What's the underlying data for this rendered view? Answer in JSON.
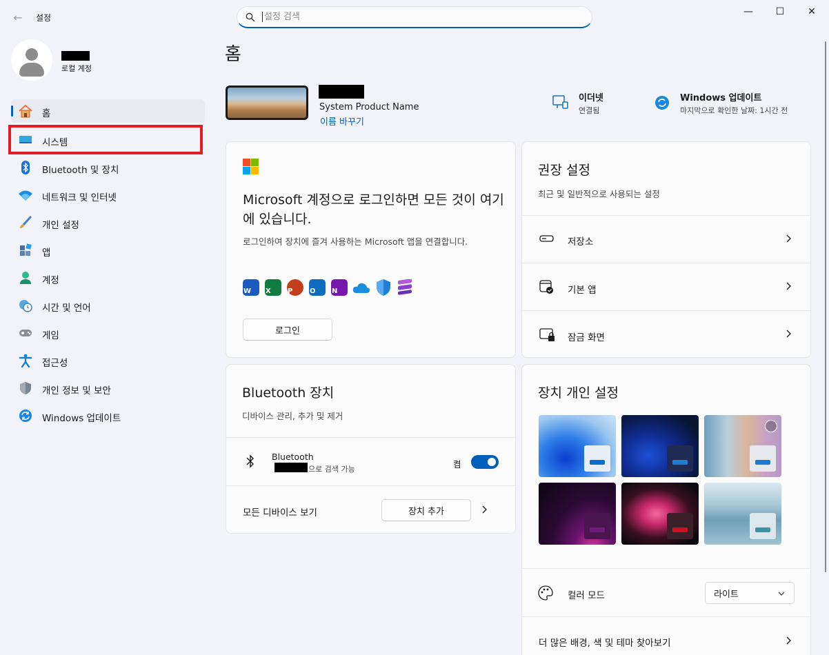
{
  "window": {
    "title": "설정",
    "back_glyph": "←",
    "minimize_glyph": "—",
    "maximize_glyph": "☐",
    "close_glyph": "✕"
  },
  "search": {
    "placeholder": "설정 검색"
  },
  "user": {
    "account_type": "로컬 계정"
  },
  "sidebar": {
    "items": [
      {
        "label": "홈",
        "icon": "home-icon"
      },
      {
        "label": "시스템",
        "icon": "monitor-icon"
      },
      {
        "label": "Bluetooth 및 장치",
        "icon": "bluetooth-icon"
      },
      {
        "label": "네트워크 및 인터넷",
        "icon": "wifi-icon"
      },
      {
        "label": "개인 설정",
        "icon": "paintbrush-icon"
      },
      {
        "label": "앱",
        "icon": "apps-icon"
      },
      {
        "label": "계정",
        "icon": "person-icon"
      },
      {
        "label": "시간 및 언어",
        "icon": "clock-globe-icon"
      },
      {
        "label": "게임",
        "icon": "gamepad-icon"
      },
      {
        "label": "접근성",
        "icon": "accessibility-icon"
      },
      {
        "label": "개인 정보 및 보안",
        "icon": "shield-icon"
      },
      {
        "label": "Windows 업데이트",
        "icon": "update-icon"
      }
    ],
    "active_index": 0,
    "highlighted_index": 1
  },
  "main": {
    "page_title": "홈",
    "device": {
      "model": "System Product Name",
      "rename_label": "이름 바꾸기"
    },
    "status": {
      "ethernet_title": "이더넷",
      "ethernet_sub": "연결됨",
      "update_title": "Windows 업데이트",
      "update_sub": "마지막으로 확인한 날짜: 1시간 전"
    },
    "ms_card": {
      "title": "Microsoft 계정으로 로그인하면 모든 것이 여기에 있습니다.",
      "desc": "로그인하여 장치에 즐겨 사용하는 Microsoft 앱을 연결합니다.",
      "apps": [
        {
          "letter": "W",
          "color": "#185abd",
          "icon": "word-icon"
        },
        {
          "letter": "X",
          "color": "#107c41",
          "icon": "excel-icon"
        },
        {
          "letter": "P",
          "color": "#c43e1c",
          "icon": "powerpoint-icon"
        },
        {
          "letter": "O",
          "color": "#0f6cbd",
          "icon": "outlook-icon"
        },
        {
          "letter": "N",
          "color": "#7719aa",
          "icon": "onenote-icon"
        },
        {
          "letter": "",
          "color": "#1a8de0",
          "icon": "onedrive-icon"
        },
        {
          "letter": "",
          "color": "#1f7fd6",
          "icon": "defender-icon"
        },
        {
          "letter": "",
          "color": "#8b3fd1",
          "icon": "clipchamp-icon"
        }
      ],
      "signin_label": "로그인"
    },
    "recommended": {
      "title": "권장 설정",
      "sub": "최근 및 일반적으로 사용되는 설정",
      "rows": [
        {
          "label": "저장소",
          "icon": "storage-icon"
        },
        {
          "label": "기본 앱",
          "icon": "default-apps-icon"
        },
        {
          "label": "잠금 화면",
          "icon": "lock-screen-icon"
        }
      ]
    },
    "bluetooth": {
      "title": "Bluetooth 장치",
      "sub": "디바이스 관리, 추가 및 제거",
      "device_label": "Bluetooth",
      "discover_suffix": "으로 검색 가능",
      "toggle_label": "켬",
      "toggle_on": true,
      "view_all": "모든 디바이스 보기",
      "add_device": "장치 추가"
    },
    "personalize": {
      "title": "장치 개인 설정",
      "themes": [
        {
          "bg": "#5b9bd5",
          "accent": "#0a5ad6",
          "mini": "#e8eef6",
          "bar": "#0b6fd1"
        },
        {
          "bg": "#0c1636",
          "accent": "#1e4fd8",
          "mini": "#1f2b55",
          "bar": "#1f7dd6"
        },
        {
          "bg": "#bd9ec2",
          "accent": "#e8d7e2",
          "mini": "#e6e8ee",
          "bar": "#1a7bd4"
        },
        {
          "bg": "#1e0a2a",
          "accent": "#9a1a8a",
          "mini": "#4b1650",
          "bar": "#6e1d7a"
        },
        {
          "bg": "#120d14",
          "accent": "#e23d7a",
          "mini": "#3a2028",
          "bar": "#d01020"
        },
        {
          "bg": "#8fb6c9",
          "accent": "#6f9fb8",
          "mini": "#dbe7ec",
          "bar": "#3a94a8"
        }
      ],
      "color_mode_label": "컬러 모드",
      "color_mode_value": "라이트",
      "more_label": "더 많은 배경, 색 및 테마 찾아보기"
    }
  }
}
